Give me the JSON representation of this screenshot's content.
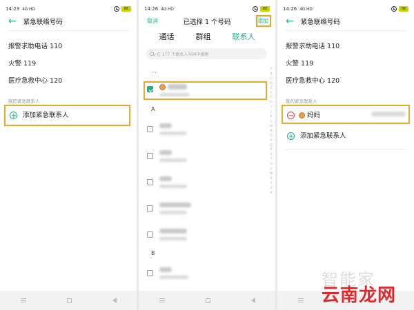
{
  "screen1": {
    "status": {
      "time": "14:23",
      "network": "4G HD",
      "battery": "88"
    },
    "title": "紧急联络号码",
    "items": [
      "报警求助电话 110",
      "火警 119",
      "医疗急救中心 120"
    ],
    "section_label": "我的紧急联系人",
    "add_label": "添加紧急联系人"
  },
  "screen2": {
    "status": {
      "time": "14:26",
      "network": "4G HD",
      "battery": "88"
    },
    "cancel_label": "取消",
    "title": "已选择 1 个号码",
    "add_label": "添加",
    "tabs": [
      {
        "label": "通话"
      },
      {
        "label": "群组"
      },
      {
        "label": "联系人"
      }
    ],
    "active_tab": "联系人",
    "search_placeholder": "在 177 个联系人号码中搜索",
    "ellipsis": "…",
    "groups": [
      "A",
      "B"
    ],
    "index_letters": [
      "A",
      "B",
      "C",
      "D",
      "E",
      "F",
      "G",
      "H",
      "I",
      "J",
      "K",
      "L",
      "M",
      "N",
      "O",
      "P",
      "Q",
      "R",
      "S",
      "T",
      "U",
      "V",
      "W",
      "X",
      "Y",
      "Z",
      "#"
    ]
  },
  "screen3": {
    "status": {
      "time": "14:26",
      "network": "4G HD",
      "battery": "88"
    },
    "title": "紧急联络号码",
    "items": [
      "报警求助电话 110",
      "火警 119",
      "医疗急救中心 120"
    ],
    "section_label": "我的紧急联系人",
    "contact_name": "妈妈",
    "add_label": "添加紧急联系人"
  },
  "watermark": {
    "text": "智能家",
    "brand": "云南龙网"
  },
  "colors": {
    "accent": "#1db37d",
    "highlight": "#e9a82a",
    "remove": "#e2404c",
    "brand": "#e3262c"
  }
}
